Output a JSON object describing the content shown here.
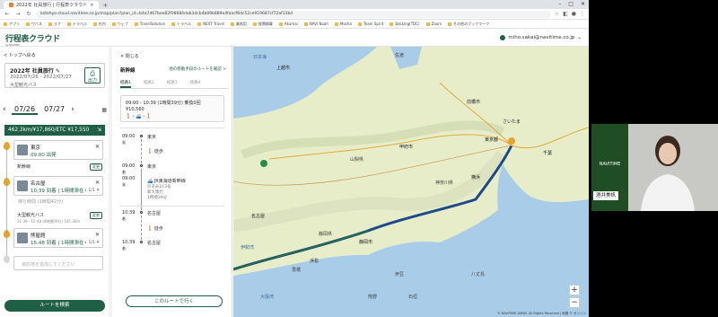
{
  "browser": {
    "tabs": [
      {
        "label": "2022年 社員旅行 | 行程表クラウド",
        "active": true
      }
    ],
    "url": "kotehyo-cloud.navitime.co.jp/map/plan?plan_id=b4a7d67bee82f08684dab3dcb4b89b889e4faacf6dc52ce919687cf72af33bd",
    "bookmarks": [
      "アプリ",
      "ワバス",
      "ラフ",
      "トラベル",
      "社内",
      "ウェブ",
      "TravelSolution",
      "トラベル",
      "NEXT Travel",
      "業務用",
      "経費精算",
      "Akamai",
      "NAVI Noah",
      "Mocha",
      "Team Spirit",
      "Backlog(TDC)",
      "Zoom",
      "その他のブックマーク"
    ]
  },
  "app": {
    "logo": "行程表クラウド",
    "logo_sub": "by NAVITIME",
    "user": "miho.sakai@navitime.co.jp"
  },
  "left": {
    "back": "< トップへ戻る",
    "trip": {
      "title": "2022年 社員旅行 ✎",
      "dates": "2022/07/26 - 2022/07/27",
      "type": "大型観光バス"
    },
    "output_label": "出力",
    "days": [
      "07/26",
      "07/27"
    ],
    "summary": {
      "text": "462.3km/¥17,860/ETC ¥17,550"
    },
    "stops": [
      {
        "name": "東京",
        "time": "09:00 出発"
      },
      {
        "name": "名古屋",
        "time": "10:39 到着 | 1時間滞在",
        "arrow": "↓ 1/1 ✕"
      },
      {
        "name": "熊屋館",
        "time": "15:48 到着 | 1時間滞在",
        "arrow": "↓ 1/1 ✕"
      }
    ],
    "legs": [
      {
        "mode": "新幹線",
        "change": "変更"
      },
      {
        "mode": "大型観光バス",
        "sub": "11:39 - 15:48 (4時間09分) 145.3km",
        "change": "変更"
      }
    ],
    "wait": "待ち時間 (1時間42分)",
    "new_stop_placeholder": "目的地を追加してください",
    "search_button": "ルートを検索"
  },
  "route": {
    "close": "✕ 閉じる",
    "title": "新幹線",
    "other": "他の移動手段のルートを確認 >",
    "tabs": [
      "経路1",
      "経路2",
      "経路3",
      "経路4"
    ],
    "summary": {
      "time": "09:00 - 10:39 (1時間39分) 乗換0回",
      "fare": "¥10,560",
      "icons": "🚶 › 🚄 › 🚶"
    },
    "steps": [
      {
        "time": "09:00",
        "sub": "発",
        "station": "東京"
      },
      {
        "walk": "徒歩"
      },
      {
        "time": "09:00",
        "sub": "着",
        "station": "東京"
      },
      {
        "time": "09:00",
        "sub": "発",
        "station": ""
      },
      {
        "time": "10:39",
        "sub": "着",
        "station": "名古屋"
      },
      {
        "walk": "徒歩"
      },
      {
        "time": "10:39",
        "sub": "着",
        "station": "名古屋"
      }
    ],
    "rail": "🚄 JR東海道新幹線",
    "rail_sub": "のぞみ213号\n新大阪行\n1時間39分",
    "go_button": "このルートで行く"
  },
  "map": {
    "labels": [
      "上越市",
      "日本海",
      "佐渡",
      "前橋市",
      "さいたま",
      "東京都",
      "千葉",
      "甲府市",
      "山梨県",
      "横浜",
      "静岡県",
      "静岡市",
      "浜松",
      "名古屋",
      "豊橋",
      "伊豆",
      "神奈川県",
      "伊勢湾",
      "大阪湾",
      "熊野",
      "石垣",
      "八丈島"
    ],
    "zoom_in": "+",
    "zoom_out": "−",
    "copyright": "© NAVITIME JAPAN. All Rights Reserved | 地図 © ゼンリン"
  },
  "camera": {
    "logo": "NAVITIME",
    "name": "酒井美帆"
  }
}
